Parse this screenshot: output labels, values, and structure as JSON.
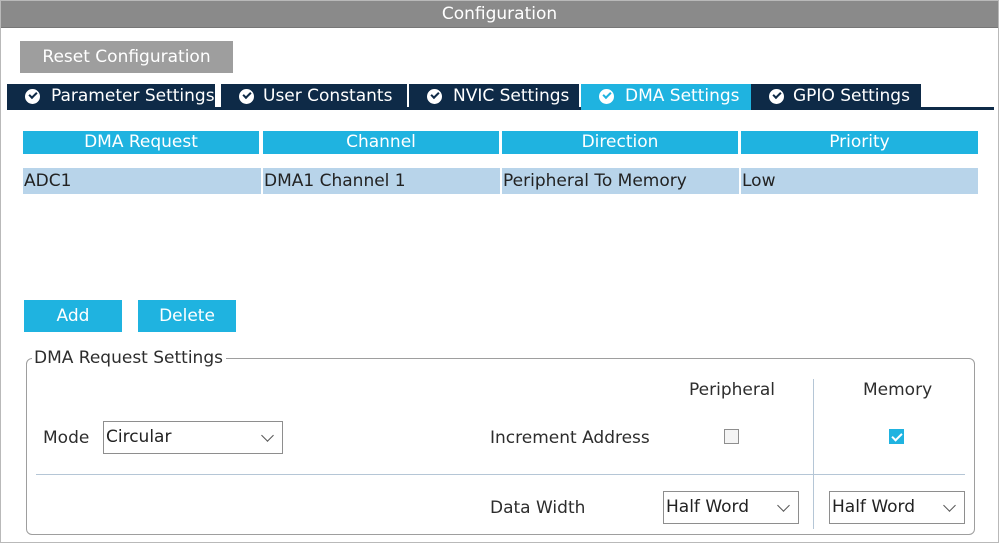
{
  "window": {
    "title": "Configuration"
  },
  "toolbar": {
    "reset_label": "Reset Configuration"
  },
  "tabs": [
    {
      "label": "Parameter Settings",
      "icon": "check-circle-icon",
      "active": false
    },
    {
      "label": "User Constants",
      "icon": "check-circle-icon",
      "active": false
    },
    {
      "label": "NVIC Settings",
      "icon": "check-circle-icon",
      "active": false
    },
    {
      "label": "DMA Settings",
      "icon": "check-circle-icon",
      "active": true
    },
    {
      "label": "GPIO Settings",
      "icon": "check-circle-icon",
      "active": false
    }
  ],
  "dma_table": {
    "columns": [
      "DMA Request",
      "Channel",
      "Direction",
      "Priority"
    ],
    "rows": [
      [
        "ADC1",
        "DMA1 Channel 1",
        "Peripheral To Memory",
        "Low"
      ]
    ]
  },
  "actions": {
    "add_label": "Add",
    "delete_label": "Delete"
  },
  "request_settings": {
    "legend": "DMA Request Settings",
    "mode_label": "Mode",
    "mode_value": "Circular",
    "col_peripheral": "Peripheral",
    "col_memory": "Memory",
    "increment_label": "Increment Address",
    "increment_peripheral": false,
    "increment_memory": true,
    "data_width_label": "Data Width",
    "data_width_peripheral": "Half Word",
    "data_width_memory": "Half Word"
  },
  "colors": {
    "accent": "#1fb3e0",
    "tab_dark": "#0e2a47",
    "selected_row": "#b8d4ea",
    "titlebar": "#8a8a8a"
  }
}
